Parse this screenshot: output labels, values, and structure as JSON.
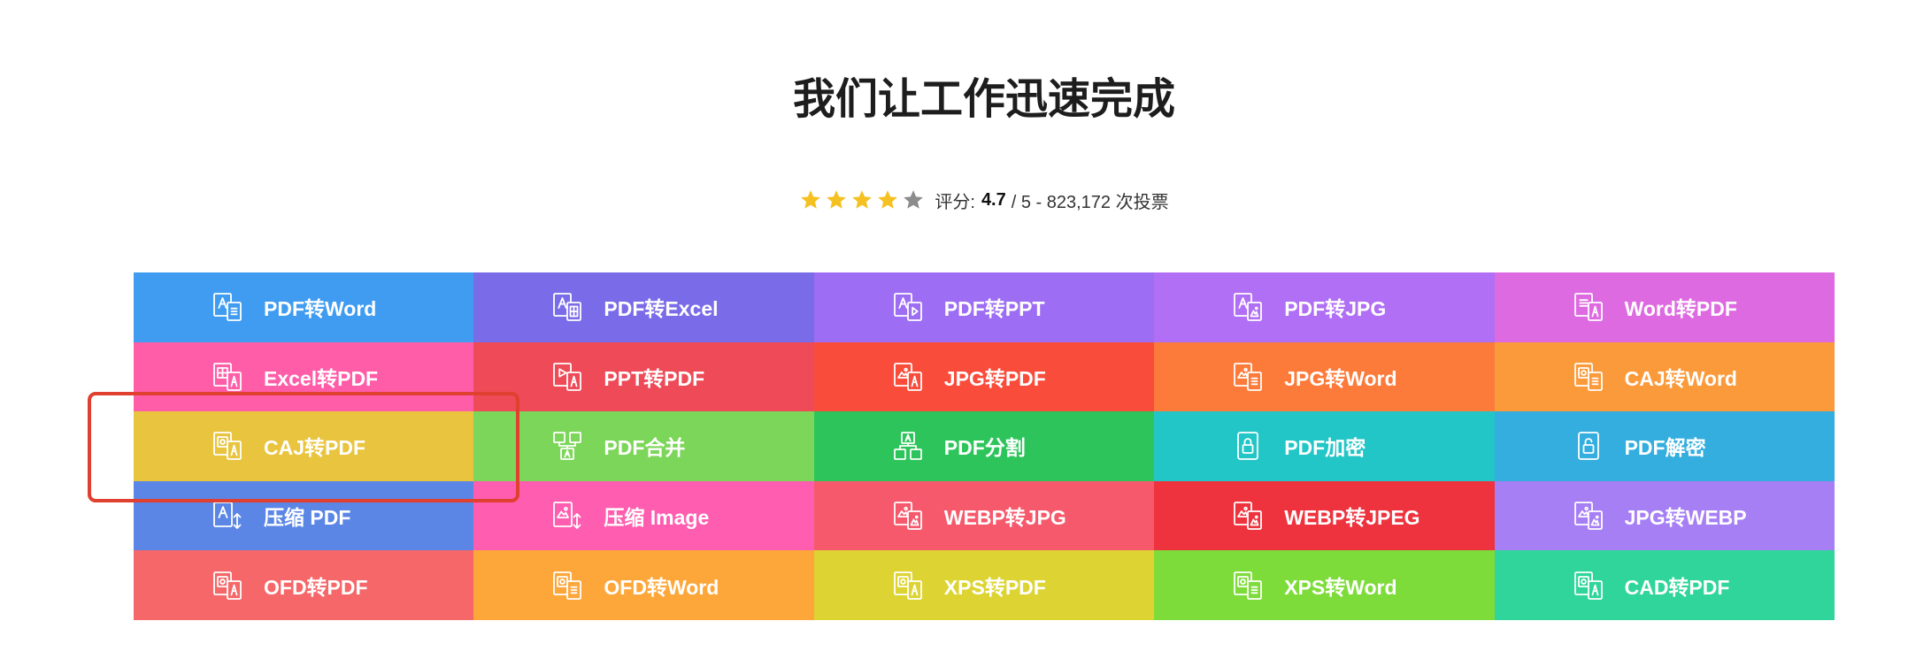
{
  "page": {
    "title": "我们让工作迅速完成"
  },
  "rating": {
    "label": "评分:",
    "value": "4.7",
    "suffix": "/ 5 - 823,172 次投票",
    "stars_filled": 4,
    "stars_total": 5,
    "star_color": "#F5C122",
    "star_empty_color": "#8C8C8C"
  },
  "tools": [
    {
      "label": "PDF转Word",
      "icon": "pdf-to-word-icon",
      "color": "#3F9CF1"
    },
    {
      "label": "PDF转Excel",
      "icon": "pdf-to-excel-icon",
      "color": "#7A6CE8"
    },
    {
      "label": "PDF转PPT",
      "icon": "pdf-to-ppt-icon",
      "color": "#9D6DF3"
    },
    {
      "label": "PDF转JPG",
      "icon": "pdf-to-jpg-icon",
      "color": "#B06FF4"
    },
    {
      "label": "Word转PDF",
      "icon": "word-to-pdf-icon",
      "color": "#DE6AE1"
    },
    {
      "label": "Excel转PDF",
      "icon": "excel-to-pdf-icon",
      "color": "#FF5DA8"
    },
    {
      "label": "PPT转PDF",
      "icon": "ppt-to-pdf-icon",
      "color": "#EE4A57"
    },
    {
      "label": "JPG转PDF",
      "icon": "jpg-to-pdf-icon",
      "color": "#FA4C3B"
    },
    {
      "label": "JPG转Word",
      "icon": "jpg-to-word-icon",
      "color": "#FC7B3A"
    },
    {
      "label": "CAJ转Word",
      "icon": "caj-to-word-icon",
      "color": "#FB9A3B"
    },
    {
      "label": "CAJ转PDF",
      "icon": "caj-to-pdf-icon",
      "color": "#E9C43F"
    },
    {
      "label": "PDF合并",
      "icon": "pdf-merge-icon",
      "color": "#7CD659"
    },
    {
      "label": "PDF分割",
      "icon": "pdf-split-icon",
      "color": "#2DC55B"
    },
    {
      "label": "PDF加密",
      "icon": "pdf-encrypt-icon",
      "color": "#22C6C7"
    },
    {
      "label": "PDF解密",
      "icon": "pdf-decrypt-icon",
      "color": "#33AEDE"
    },
    {
      "label": "压缩 PDF",
      "icon": "compress-pdf-icon",
      "color": "#5B86E5"
    },
    {
      "label": "压缩 Image",
      "icon": "compress-image-icon",
      "color": "#FF5DAF"
    },
    {
      "label": "WEBP转JPG",
      "icon": "webp-to-jpg-icon",
      "color": "#F6596C"
    },
    {
      "label": "WEBP转JPEG",
      "icon": "webp-to-jpeg-icon",
      "color": "#EE333E"
    },
    {
      "label": "JPG转WEBP",
      "icon": "jpg-to-webp-icon",
      "color": "#A77FF5"
    },
    {
      "label": "OFD转PDF",
      "icon": "ofd-to-pdf-icon",
      "color": "#F56769"
    },
    {
      "label": "OFD转Word",
      "icon": "ofd-to-word-icon",
      "color": "#FDA73B"
    },
    {
      "label": "XPS转PDF",
      "icon": "xps-to-pdf-icon",
      "color": "#DDD434"
    },
    {
      "label": "XPS转Word",
      "icon": "xps-to-word-icon",
      "color": "#7EDC3A"
    },
    {
      "label": "CAD转PDF",
      "icon": "cad-to-pdf-icon",
      "color": "#2FD59B"
    }
  ],
  "annotation": {
    "color": "#E0402F"
  }
}
